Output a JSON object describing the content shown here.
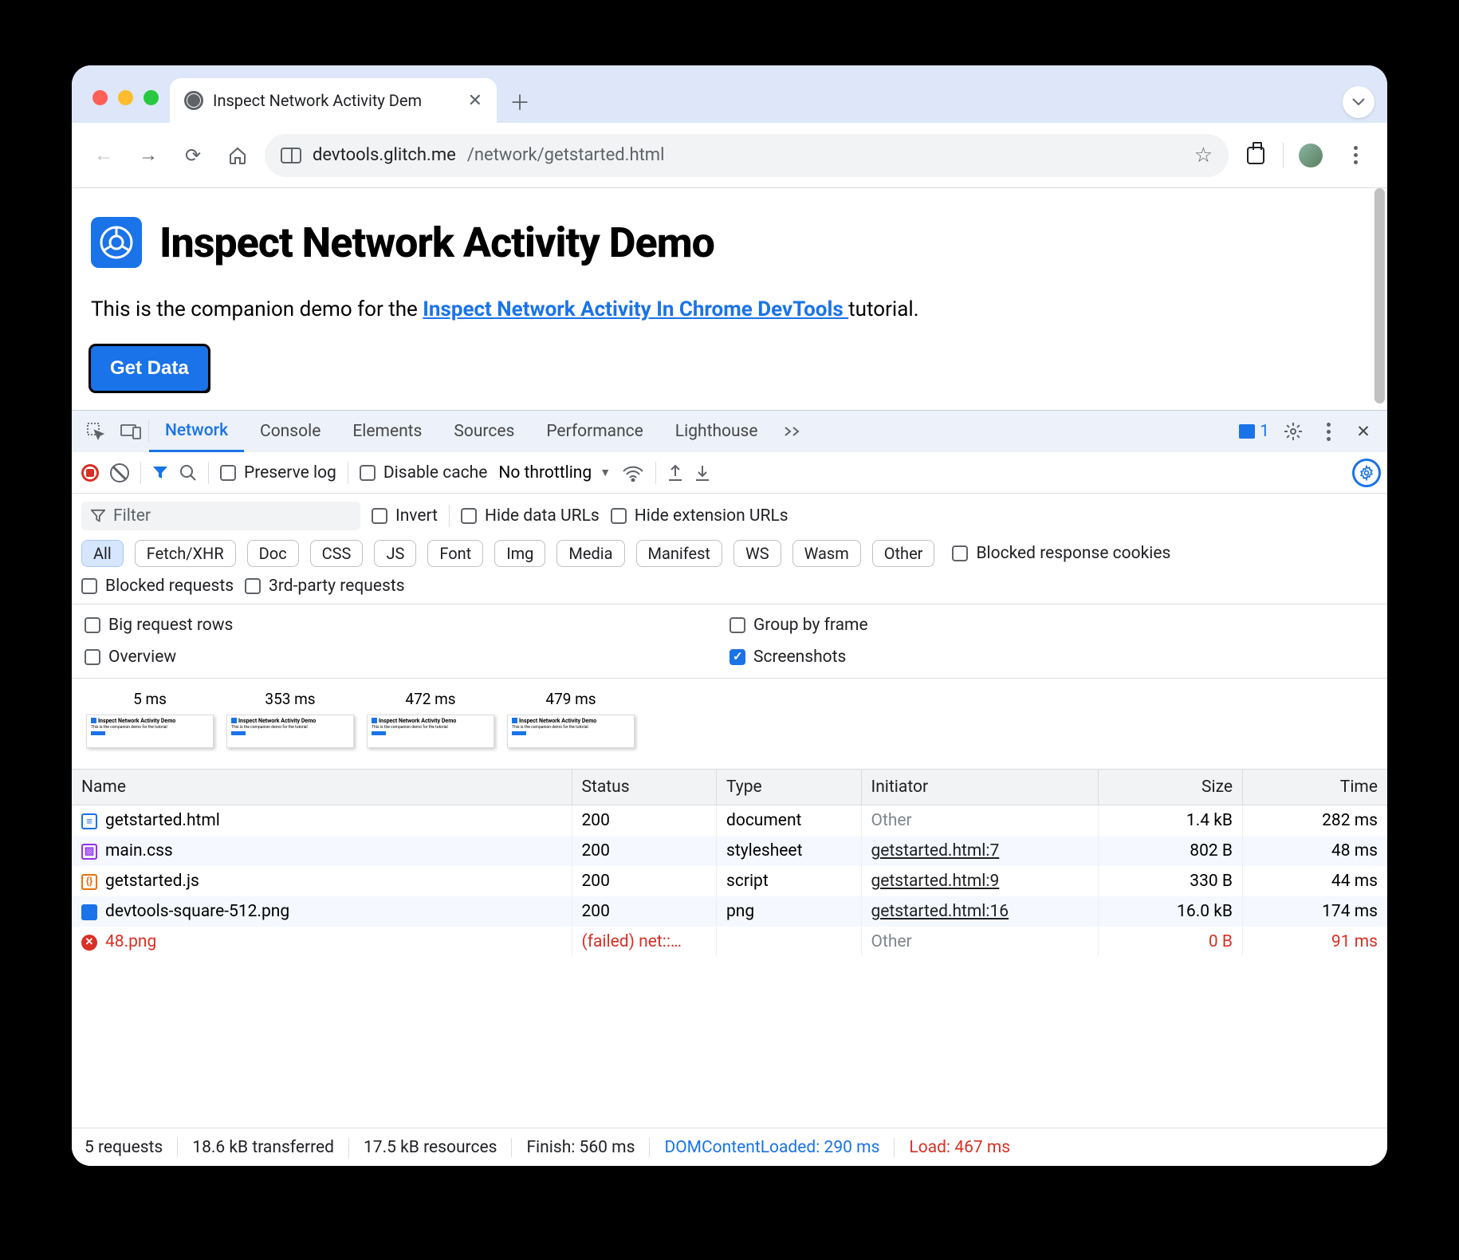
{
  "browser": {
    "tab_title": "Inspect Network Activity Dem",
    "url_host": "devtools.glitch.me",
    "url_path": "/network/getstarted.html"
  },
  "page": {
    "heading": "Inspect Network Activity Demo",
    "desc_pre": "This is the companion demo for the ",
    "desc_link": "Inspect Network Activity In Chrome DevTools ",
    "desc_post": "tutorial.",
    "button": "Get Data"
  },
  "devtools": {
    "tabs": [
      "Network",
      "Console",
      "Elements",
      "Sources",
      "Performance",
      "Lighthouse"
    ],
    "active_tab": "Network",
    "issues_count": "1",
    "controls": {
      "preserve_log": "Preserve log",
      "disable_cache": "Disable cache",
      "throttling": "No throttling"
    },
    "filter": {
      "placeholder": "Filter",
      "invert": "Invert",
      "hide_data": "Hide data URLs",
      "hide_ext": "Hide extension URLs",
      "chips": [
        "All",
        "Fetch/XHR",
        "Doc",
        "CSS",
        "JS",
        "Font",
        "Img",
        "Media",
        "Manifest",
        "WS",
        "Wasm",
        "Other"
      ],
      "blocked_cookies": "Blocked response cookies",
      "blocked_req": "Blocked requests",
      "third_party": "3rd-party requests"
    },
    "options": {
      "big_rows": "Big request rows",
      "overview": "Overview",
      "group_frame": "Group by frame",
      "screenshots": "Screenshots"
    },
    "filmstrip": [
      "5 ms",
      "353 ms",
      "472 ms",
      "479 ms"
    ],
    "columns": [
      "Name",
      "Status",
      "Type",
      "Initiator",
      "Size",
      "Time"
    ],
    "rows": [
      {
        "icon": "doc",
        "name": "getstarted.html",
        "status": "200",
        "type": "document",
        "initiator": "Other",
        "initiator_muted": true,
        "size": "1.4 kB",
        "time": "282 ms"
      },
      {
        "icon": "css",
        "name": "main.css",
        "status": "200",
        "type": "stylesheet",
        "initiator": "getstarted.html:7",
        "size": "802 B",
        "time": "48 ms"
      },
      {
        "icon": "js",
        "name": "getstarted.js",
        "status": "200",
        "type": "script",
        "initiator": "getstarted.html:9",
        "size": "330 B",
        "time": "44 ms"
      },
      {
        "icon": "img",
        "name": "devtools-square-512.png",
        "status": "200",
        "type": "png",
        "initiator": "getstarted.html:16",
        "size": "16.0 kB",
        "time": "174 ms"
      },
      {
        "icon": "err",
        "name": "48.png",
        "status": "(failed) net::…",
        "type": "",
        "initiator": "Other",
        "initiator_muted": true,
        "size": "0 B",
        "time": "91 ms",
        "error": true
      }
    ],
    "status_bar": {
      "requests": "5 requests",
      "transferred": "18.6 kB transferred",
      "resources": "17.5 kB resources",
      "finish": "Finish: 560 ms",
      "dcl": "DOMContentLoaded: 290 ms",
      "load": "Load: 467 ms"
    }
  }
}
